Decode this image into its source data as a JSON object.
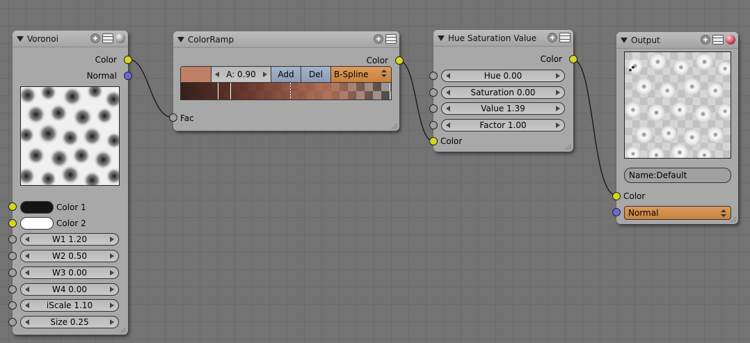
{
  "nodes": {
    "voronoi": {
      "title": "Voronoi",
      "outputs": [
        "Color",
        "Normal"
      ],
      "color1_label": "Color 1",
      "color2_label": "Color 2",
      "color1_value": "#151515",
      "color2_value": "#ffffff",
      "sliders": [
        "W1 1.20",
        "W2 0.50",
        "W3 0.00",
        "W4 0.00",
        "iScale 1.10",
        "Size 0.25"
      ]
    },
    "colorramp": {
      "title": "ColorRamp",
      "output": "Color",
      "input": "Fac",
      "position": "A: 0.90",
      "add_label": "Add",
      "del_label": "Del",
      "interpolation": "B-Spline",
      "active_color": "#be8066"
    },
    "hsv": {
      "title": "Hue Saturation Value",
      "output": "Color",
      "sliders": [
        "Hue 0.00",
        "Saturation 0.00",
        "Value 1.39",
        "Factor 1.00"
      ],
      "input": "Color"
    },
    "output": {
      "title": "Output",
      "name_field": "Name:Default",
      "input_color": "Color",
      "normal_dropdown": "Normal"
    }
  },
  "colors": {
    "socket_color": "#d6d620",
    "socket_vector": "#6a6ad6",
    "socket_value": "#a0a0a0",
    "background": "#737373",
    "node_body": "#a8a8a8",
    "accent_orange": "#dc9a5a",
    "button_blue": "#a4b4cc"
  }
}
